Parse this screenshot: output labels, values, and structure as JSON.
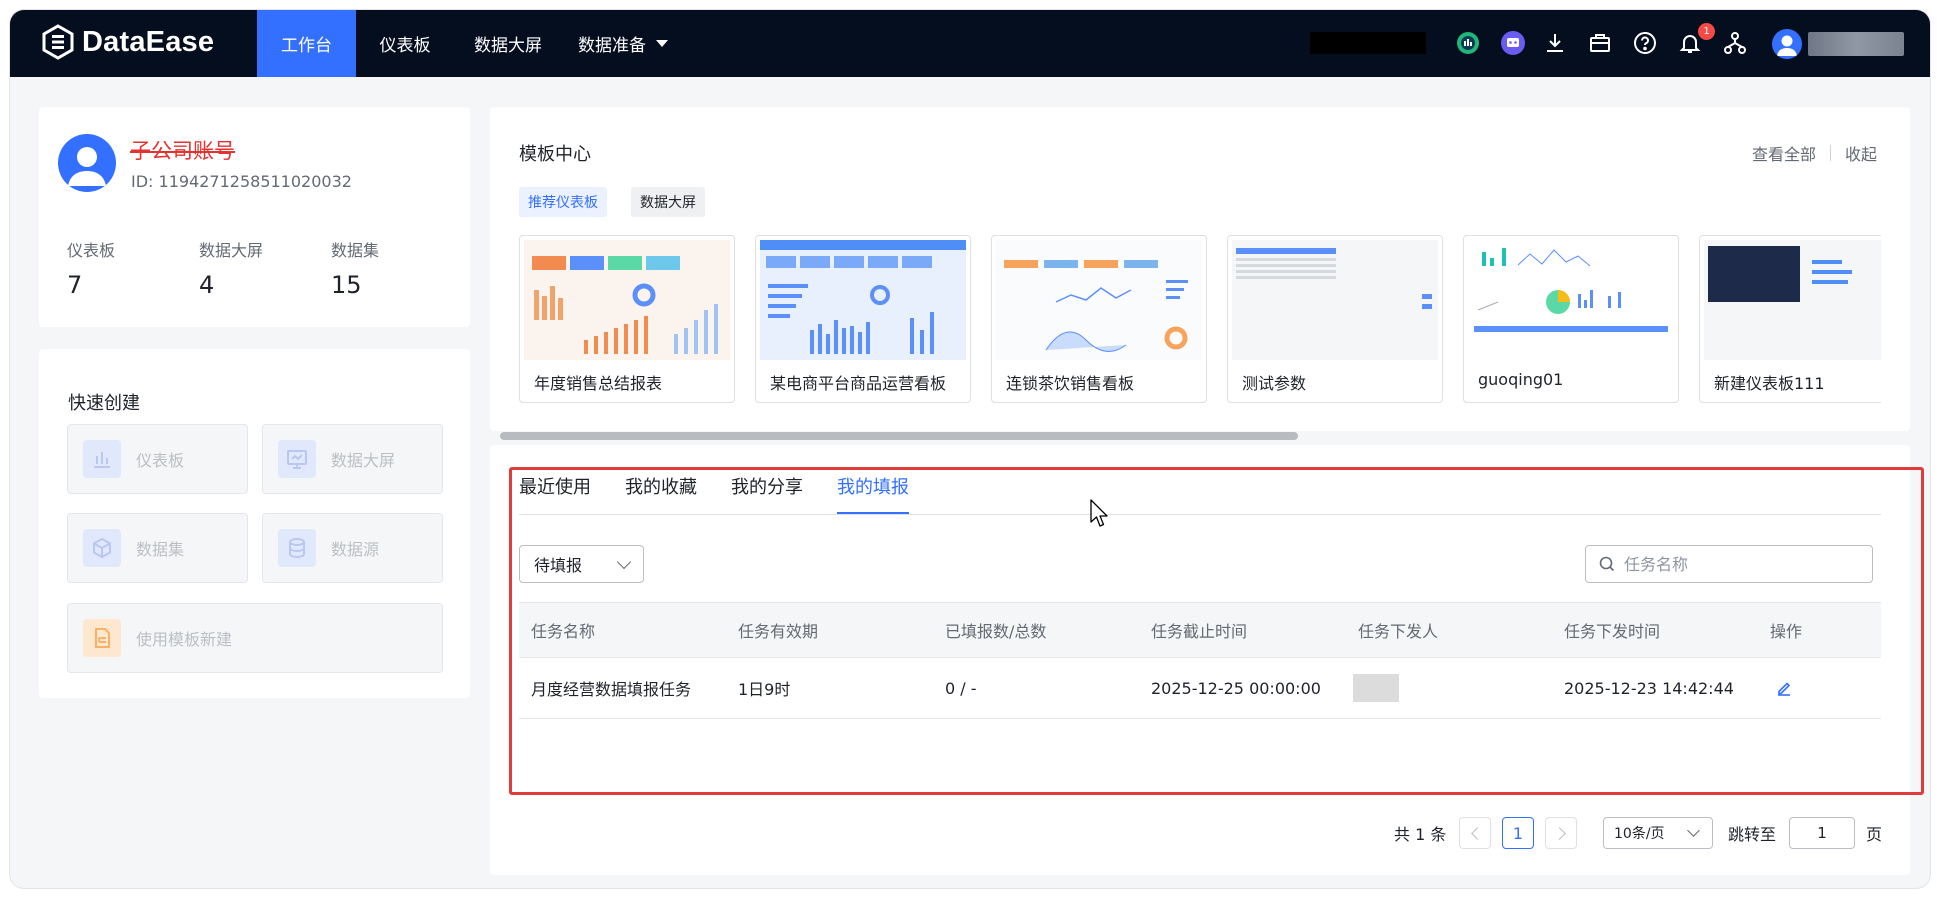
{
  "app": {
    "name": "DataEase"
  },
  "nav": {
    "items": [
      {
        "label": "工作台",
        "active": true
      },
      {
        "label": "仪表板"
      },
      {
        "label": "数据大屏"
      },
      {
        "label": "数据准备"
      }
    ]
  },
  "topbar": {
    "notification_count": "1"
  },
  "user": {
    "name": "子公司账号",
    "id_text": "ID: 1194271258511020032",
    "stats": [
      {
        "label": "仪表板",
        "value": "7"
      },
      {
        "label": "数据大屏",
        "value": "4"
      },
      {
        "label": "数据集",
        "value": "15"
      }
    ]
  },
  "quick_create": {
    "title": "快速创建",
    "dashboard": "仪表板",
    "screen": "数据大屏",
    "dataset": "数据集",
    "datasource": "数据源",
    "from_template": "使用模板新建"
  },
  "template_center": {
    "title": "模板中心",
    "view_all": "查看全部",
    "collapse": "收起",
    "tags": [
      "推荐仪表板",
      "数据大屏"
    ],
    "items": [
      "年度销售总结报表",
      "某电商平台商品运营看板",
      "连锁茶饮销售看板",
      "测试参数",
      "guoqing01",
      "新建仪表板111"
    ]
  },
  "tabs": [
    "最近使用",
    "我的收藏",
    "我的分享",
    "我的填报"
  ],
  "filter": {
    "status": "待填报",
    "search_placeholder": "任务名称"
  },
  "table": {
    "headers": [
      "任务名称",
      "任务有效期",
      "已填报数/总数",
      "任务截止时间",
      "任务下发人",
      "任务下发时间",
      "操作"
    ],
    "rows": [
      {
        "name": "月度经营数据填报任务",
        "validity": "1日9时",
        "progress": "0 / -",
        "deadline": "2025-12-25 00:00:00",
        "issued_at": "2025-12-23 14:42:44"
      }
    ]
  },
  "pagination": {
    "total": "共 1 条",
    "current": "1",
    "page_size": "10条/页",
    "jump_label": "跳转至",
    "jump_value": "1",
    "page_unit": "页"
  },
  "colors": {
    "brand": "#3370ff",
    "topbar": "#050e1f",
    "highlight": "#e03c3c"
  }
}
